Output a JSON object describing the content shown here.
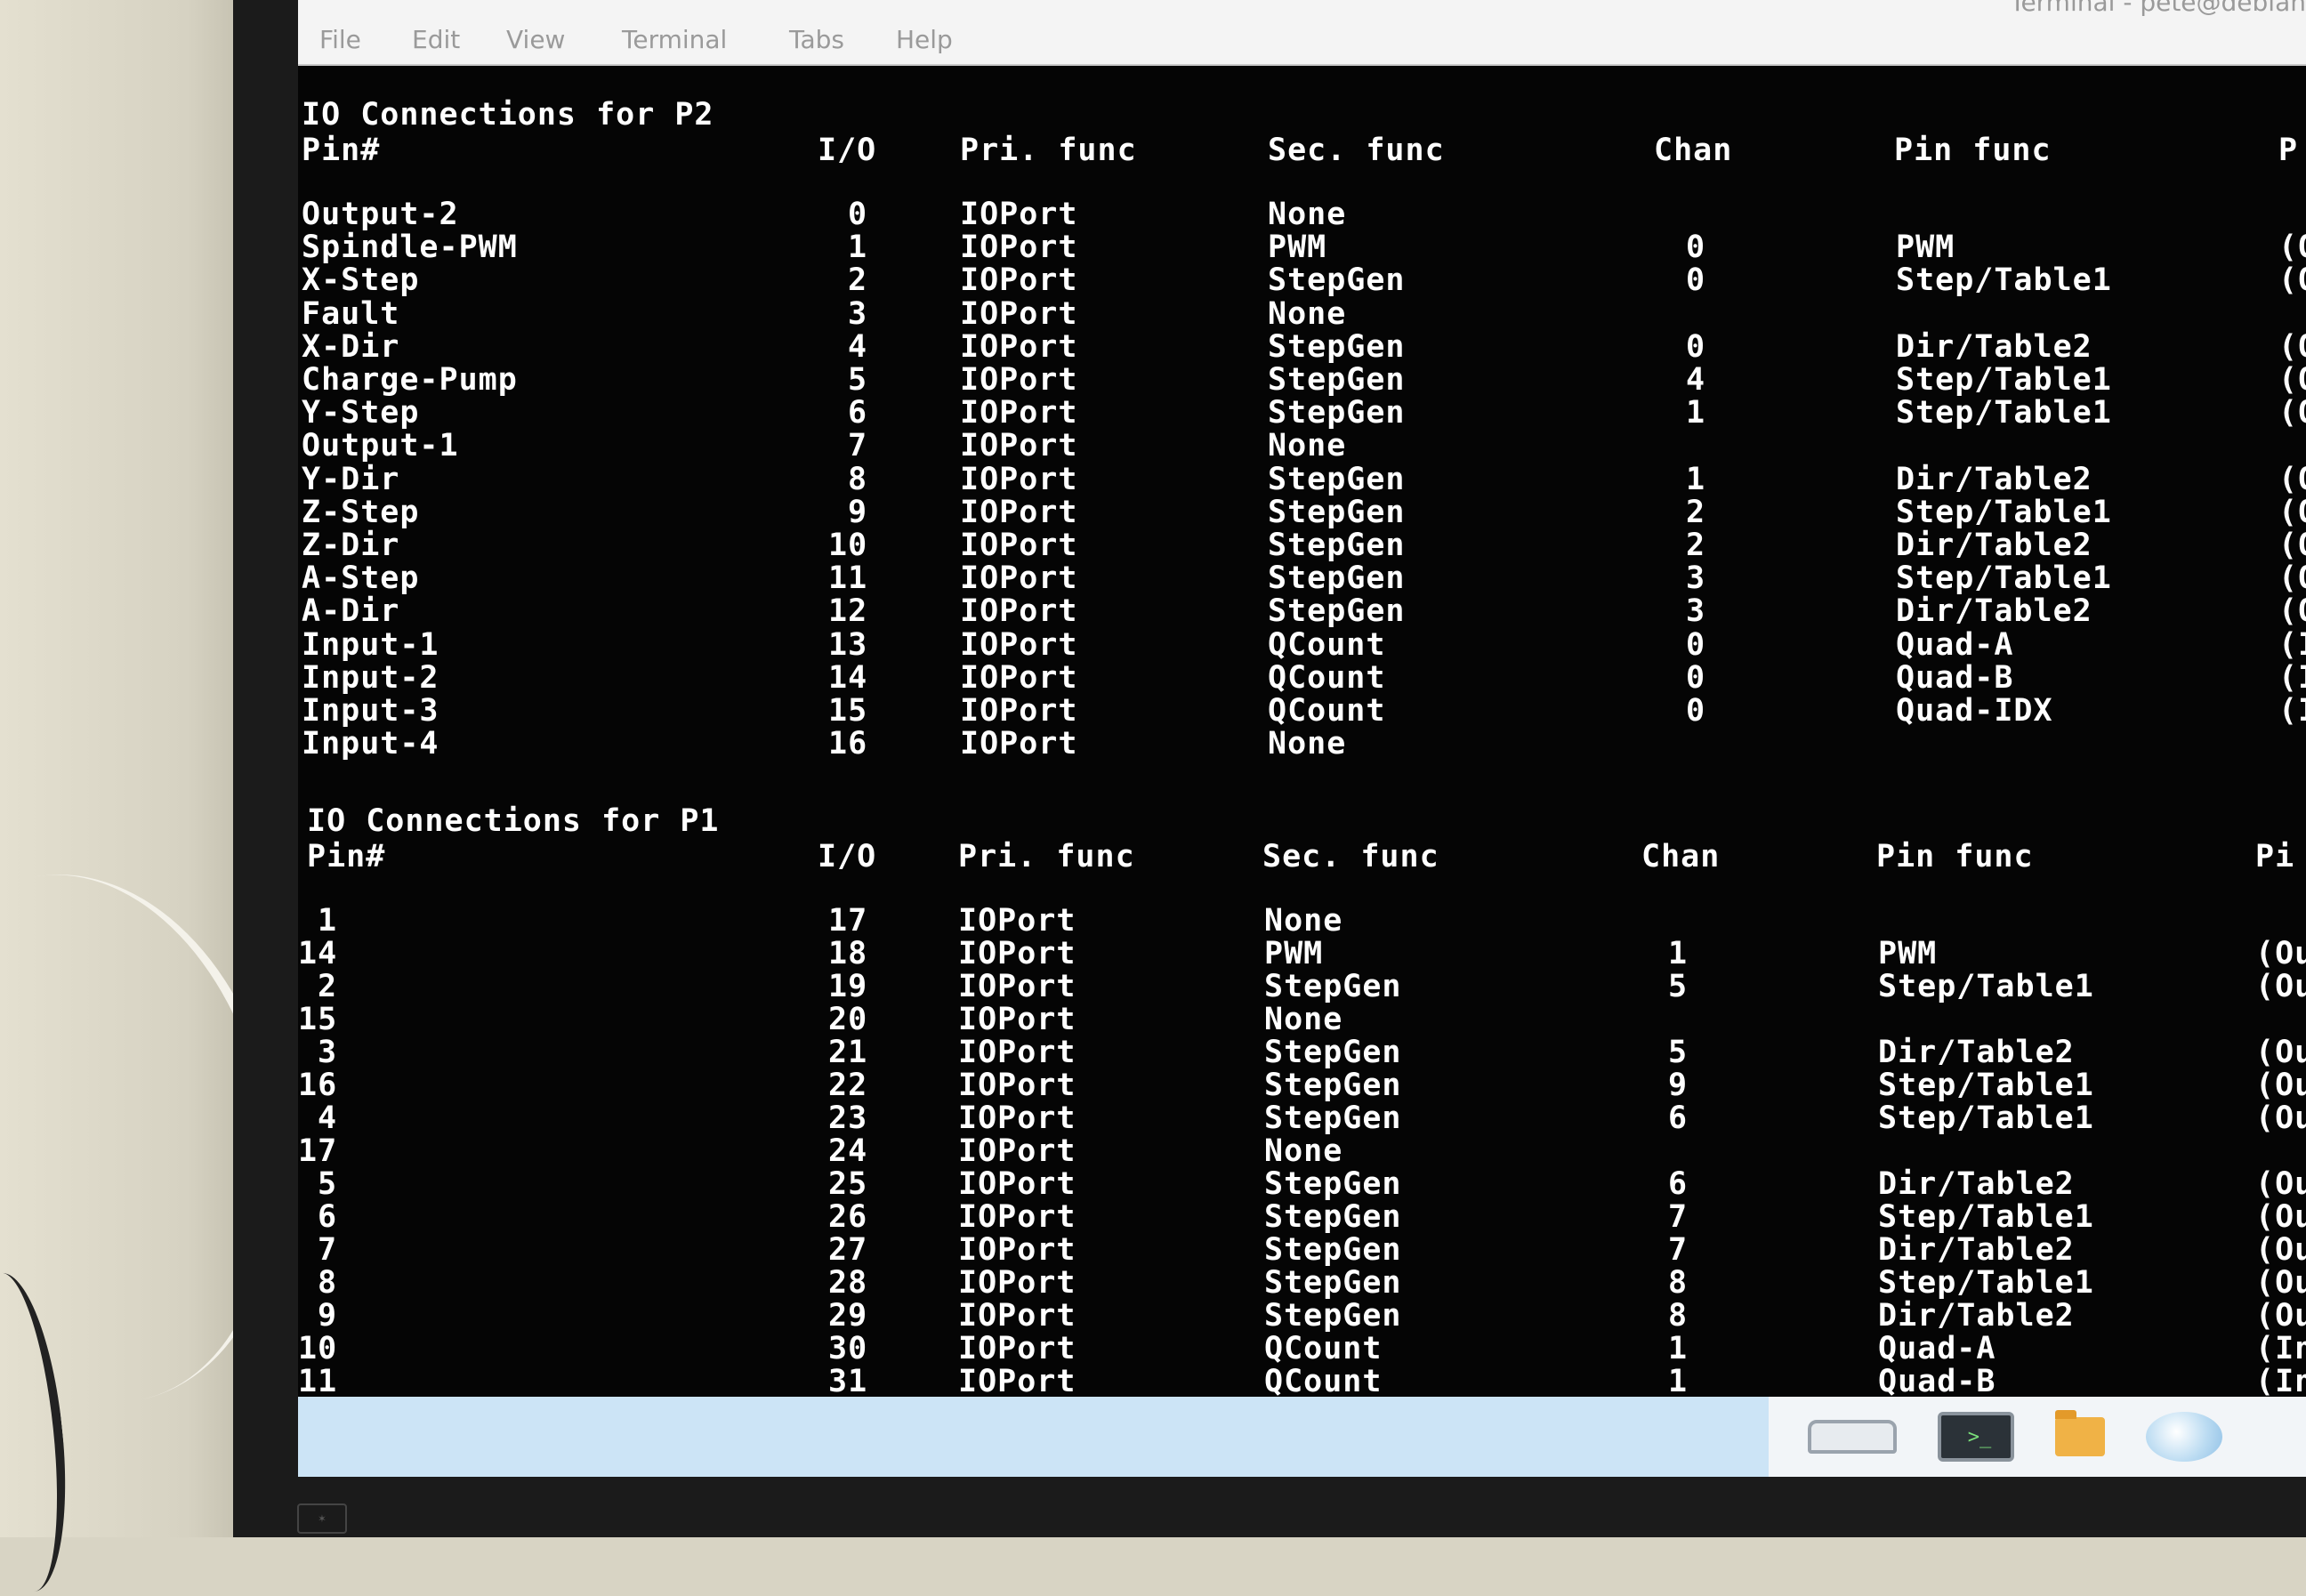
{
  "window": {
    "title": "Terminal - pete@debian",
    "menu": [
      "File",
      "Edit",
      "View",
      "Terminal",
      "Tabs",
      "Help"
    ]
  },
  "sections": [
    {
      "heading": "IO Connections for P2",
      "columns": [
        "Pin#",
        "I/O",
        "Pri. func",
        "Sec. func",
        "Chan",
        "Pin func",
        "P"
      ],
      "rows": [
        {
          "pin": "Output-2",
          "io": "0",
          "pri": "IOPort",
          "sec": "None",
          "chan": "",
          "pinfunc": "",
          "p": ""
        },
        {
          "pin": "Spindle-PWM",
          "io": "1",
          "pri": "IOPort",
          "sec": "PWM",
          "chan": "0",
          "pinfunc": "PWM",
          "p": "(O"
        },
        {
          "pin": "X-Step",
          "io": "2",
          "pri": "IOPort",
          "sec": "StepGen",
          "chan": "0",
          "pinfunc": "Step/Table1",
          "p": "(O"
        },
        {
          "pin": "Fault",
          "io": "3",
          "pri": "IOPort",
          "sec": "None",
          "chan": "",
          "pinfunc": "",
          "p": ""
        },
        {
          "pin": "X-Dir",
          "io": "4",
          "pri": "IOPort",
          "sec": "StepGen",
          "chan": "0",
          "pinfunc": "Dir/Table2",
          "p": "(O"
        },
        {
          "pin": "Charge-Pump",
          "io": "5",
          "pri": "IOPort",
          "sec": "StepGen",
          "chan": "4",
          "pinfunc": "Step/Table1",
          "p": "(O"
        },
        {
          "pin": "Y-Step",
          "io": "6",
          "pri": "IOPort",
          "sec": "StepGen",
          "chan": "1",
          "pinfunc": "Step/Table1",
          "p": "(O"
        },
        {
          "pin": "Output-1",
          "io": "7",
          "pri": "IOPort",
          "sec": "None",
          "chan": "",
          "pinfunc": "",
          "p": ""
        },
        {
          "pin": "Y-Dir",
          "io": "8",
          "pri": "IOPort",
          "sec": "StepGen",
          "chan": "1",
          "pinfunc": "Dir/Table2",
          "p": "(O"
        },
        {
          "pin": "Z-Step",
          "io": "9",
          "pri": "IOPort",
          "sec": "StepGen",
          "chan": "2",
          "pinfunc": "Step/Table1",
          "p": "(O"
        },
        {
          "pin": "Z-Dir",
          "io": "10",
          "pri": "IOPort",
          "sec": "StepGen",
          "chan": "2",
          "pinfunc": "Dir/Table2",
          "p": "(O"
        },
        {
          "pin": "A-Step",
          "io": "11",
          "pri": "IOPort",
          "sec": "StepGen",
          "chan": "3",
          "pinfunc": "Step/Table1",
          "p": "(O"
        },
        {
          "pin": "A-Dir",
          "io": "12",
          "pri": "IOPort",
          "sec": "StepGen",
          "chan": "3",
          "pinfunc": "Dir/Table2",
          "p": "(O"
        },
        {
          "pin": "Input-1",
          "io": "13",
          "pri": "IOPort",
          "sec": "QCount",
          "chan": "0",
          "pinfunc": "Quad-A",
          "p": "(I"
        },
        {
          "pin": "Input-2",
          "io": "14",
          "pri": "IOPort",
          "sec": "QCount",
          "chan": "0",
          "pinfunc": "Quad-B",
          "p": "(I"
        },
        {
          "pin": "Input-3",
          "io": "15",
          "pri": "IOPort",
          "sec": "QCount",
          "chan": "0",
          "pinfunc": "Quad-IDX",
          "p": "(I"
        },
        {
          "pin": "Input-4",
          "io": "16",
          "pri": "IOPort",
          "sec": "None",
          "chan": "",
          "pinfunc": "",
          "p": ""
        }
      ]
    },
    {
      "heading": "IO Connections for P1",
      "columns": [
        "Pin#",
        "I/O",
        "Pri. func",
        "Sec. func",
        "Chan",
        "Pin func",
        "Pi"
      ],
      "rows": [
        {
          "pin": "1",
          "io": "17",
          "pri": "IOPort",
          "sec": "None",
          "chan": "",
          "pinfunc": "",
          "p": ""
        },
        {
          "pin": "14",
          "io": "18",
          "pri": "IOPort",
          "sec": "PWM",
          "chan": "1",
          "pinfunc": "PWM",
          "p": "(Ou"
        },
        {
          "pin": "2",
          "io": "19",
          "pri": "IOPort",
          "sec": "StepGen",
          "chan": "5",
          "pinfunc": "Step/Table1",
          "p": "(Ou"
        },
        {
          "pin": "15",
          "io": "20",
          "pri": "IOPort",
          "sec": "None",
          "chan": "",
          "pinfunc": "",
          "p": ""
        },
        {
          "pin": "3",
          "io": "21",
          "pri": "IOPort",
          "sec": "StepGen",
          "chan": "5",
          "pinfunc": "Dir/Table2",
          "p": "(Ou"
        },
        {
          "pin": "16",
          "io": "22",
          "pri": "IOPort",
          "sec": "StepGen",
          "chan": "9",
          "pinfunc": "Step/Table1",
          "p": "(Ou"
        },
        {
          "pin": "4",
          "io": "23",
          "pri": "IOPort",
          "sec": "StepGen",
          "chan": "6",
          "pinfunc": "Step/Table1",
          "p": "(Ou"
        },
        {
          "pin": "17",
          "io": "24",
          "pri": "IOPort",
          "sec": "None",
          "chan": "",
          "pinfunc": "",
          "p": ""
        },
        {
          "pin": "5",
          "io": "25",
          "pri": "IOPort",
          "sec": "StepGen",
          "chan": "6",
          "pinfunc": "Dir/Table2",
          "p": "(Ou"
        },
        {
          "pin": "6",
          "io": "26",
          "pri": "IOPort",
          "sec": "StepGen",
          "chan": "7",
          "pinfunc": "Step/Table1",
          "p": "(Ou"
        },
        {
          "pin": "7",
          "io": "27",
          "pri": "IOPort",
          "sec": "StepGen",
          "chan": "7",
          "pinfunc": "Dir/Table2",
          "p": "(Ou"
        },
        {
          "pin": "8",
          "io": "28",
          "pri": "IOPort",
          "sec": "StepGen",
          "chan": "8",
          "pinfunc": "Step/Table1",
          "p": "(Ou"
        },
        {
          "pin": "9",
          "io": "29",
          "pri": "IOPort",
          "sec": "StepGen",
          "chan": "8",
          "pinfunc": "Dir/Table2",
          "p": "(Ou"
        },
        {
          "pin": "10",
          "io": "30",
          "pri": "IOPort",
          "sec": "QCount",
          "chan": "1",
          "pinfunc": "Quad-A",
          "p": "(In"
        },
        {
          "pin": "11",
          "io": "31",
          "pri": "IOPort",
          "sec": "QCount",
          "chan": "1",
          "pinfunc": "Quad-B",
          "p": "(In"
        }
      ]
    }
  ],
  "taskbar": {
    "tray_icons": [
      "network-icon",
      "terminal-icon",
      "folder-icon",
      "browser-icon"
    ],
    "terminal_glyph": ">_"
  },
  "colors": {
    "terminal_bg": "#050505",
    "terminal_fg": "#ffffff",
    "menubar_bg": "#f4f4f4",
    "taskbar_bg": "#cce4f6"
  }
}
